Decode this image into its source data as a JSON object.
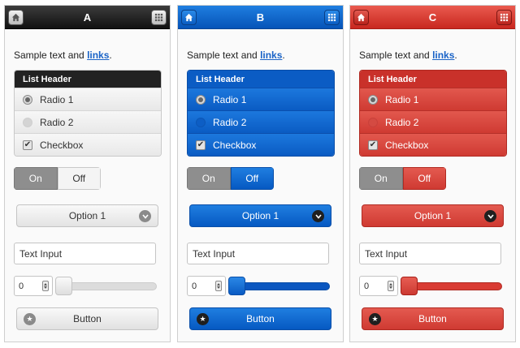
{
  "panels": [
    {
      "title": "A",
      "sample_text": "Sample text and ",
      "link_text": "links",
      "sample_end": ".",
      "list_header": "List Header",
      "radio1": "Radio 1",
      "radio2": "Radio 2",
      "checkbox": "Checkbox",
      "toggle_on": "On",
      "toggle_off": "Off",
      "select_value": "Option 1",
      "text_input": "Text Input",
      "number_value": "0",
      "slider_fraction": 0,
      "button_label": "Button"
    },
    {
      "title": "B",
      "sample_text": "Sample text and ",
      "link_text": "links",
      "sample_end": ".",
      "list_header": "List Header",
      "radio1": "Radio 1",
      "radio2": "Radio 2",
      "checkbox": "Checkbox",
      "toggle_on": "On",
      "toggle_off": "Off",
      "select_value": "Option 1",
      "text_input": "Text Input",
      "number_value": "0",
      "slider_fraction": 0,
      "button_label": "Button"
    },
    {
      "title": "C",
      "sample_text": "Sample text and ",
      "link_text": "links",
      "sample_end": ".",
      "list_header": "List Header",
      "radio1": "Radio 1",
      "radio2": "Radio 2",
      "checkbox": "Checkbox",
      "toggle_on": "On",
      "toggle_off": "Off",
      "select_value": "Option 1",
      "text_input": "Text Input",
      "number_value": "0",
      "slider_fraction": 0,
      "button_label": "Button"
    }
  ],
  "icons": {
    "home": "home-icon",
    "grid": "grid-icon",
    "chevron": "chevron-down-icon",
    "star": "star-icon",
    "check": "✔"
  },
  "colors": {
    "theme_a": "#222222",
    "theme_b": "#0b5cc4",
    "theme_c": "#d9382f",
    "link": "#1a63c7"
  }
}
